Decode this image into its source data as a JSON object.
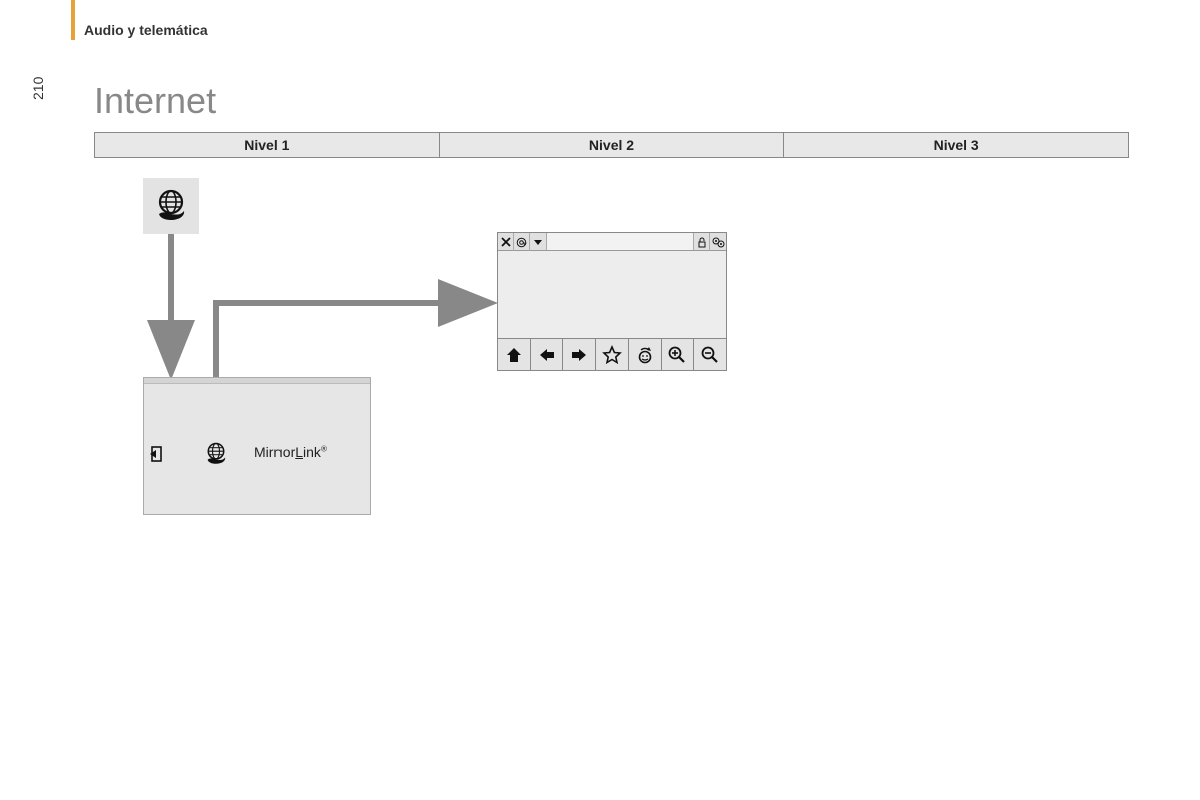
{
  "page_number": "210",
  "section_header": "Audio y telemática",
  "page_title": "Internet",
  "levels": [
    "Nivel 1",
    "Nivel 2",
    "Nivel 3"
  ],
  "app_panel": {
    "mirrorlink_label": "MirrorLink"
  },
  "icons": {
    "globe": "globe-hand-icon",
    "app_exit": "exit-icon",
    "app_globe": "globe-hand-icon",
    "browser_top": [
      "close-icon",
      "at-icon",
      "dropdown-icon",
      "lock-icon",
      "settings-icon"
    ],
    "browser_bottom": [
      "home-icon",
      "back-icon",
      "forward-icon",
      "star-icon",
      "refresh-icon",
      "zoom-in-icon",
      "zoom-out-icon"
    ]
  }
}
